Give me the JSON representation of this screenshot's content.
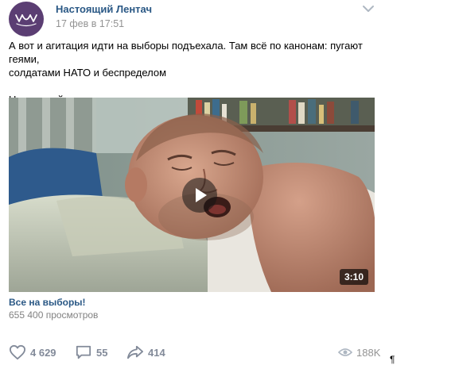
{
  "post": {
    "author": "Настоящий Лентач",
    "date": "17 фев в 17:51",
    "text_line1": "А вот и агитация идти на выборы подъехала. Там всё по канонам: пугают геями,",
    "text_line2": "солдатами НАТО и беспределом",
    "text_line3": "Наслаждайтесь:"
  },
  "video": {
    "duration": "3:10",
    "title": "Все на выборы!",
    "views": "655 400 просмотров"
  },
  "actions": {
    "likes": "4 629",
    "comments": "55",
    "shares": "414",
    "views": "188K"
  },
  "icons": {
    "avatar": "lentach-logo-icon",
    "menu": "chevron-down-icon",
    "play": "play-icon",
    "like": "heart-icon",
    "comment": "comment-icon",
    "share": "share-arrow-icon",
    "views": "eye-icon"
  },
  "colors": {
    "link": "#2a5885",
    "muted": "#939393",
    "action": "#828a99",
    "avatar_bg": "#5b3e73"
  },
  "editor_mark": "¶"
}
